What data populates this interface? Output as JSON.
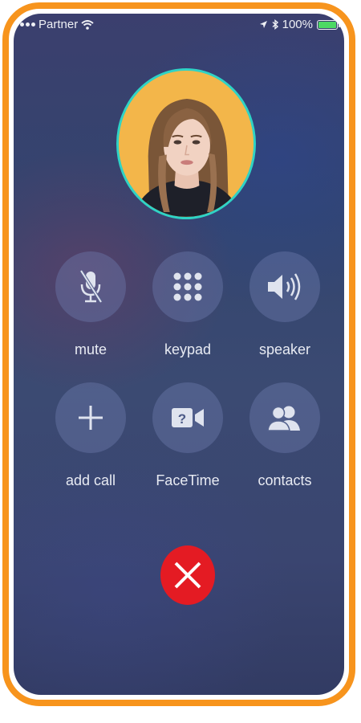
{
  "status_bar": {
    "carrier": "Partner",
    "battery": "100%",
    "battery_level": 1.0
  },
  "caller": {
    "avatar_icon": "contact-photo"
  },
  "controls": [
    {
      "id": "mute",
      "label": "mute",
      "icon": "mic-off-icon"
    },
    {
      "id": "keypad",
      "label": "keypad",
      "icon": "keypad-icon"
    },
    {
      "id": "speaker",
      "label": "speaker",
      "icon": "speaker-icon"
    },
    {
      "id": "add-call",
      "label": "add call",
      "icon": "plus-icon"
    },
    {
      "id": "facetime",
      "label": "FaceTime",
      "icon": "video-camera-icon"
    },
    {
      "id": "contacts",
      "label": "contacts",
      "icon": "contacts-icon"
    }
  ],
  "end_call": {
    "icon": "close-icon"
  },
  "colors": {
    "frame": "#f7941d",
    "avatar_ring": "#2fd3c5",
    "avatar_background": "#f3b64a",
    "end_call": "#e41b23",
    "battery": "#4cd964"
  }
}
